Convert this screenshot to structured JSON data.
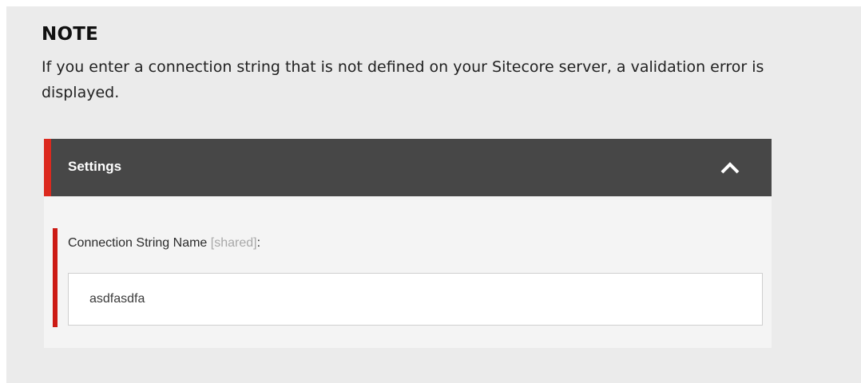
{
  "note": {
    "title": "NOTE",
    "text": "If you enter a connection string that is not defined on your Sitecore server, a validation error is displayed."
  },
  "panel": {
    "title": "Settings",
    "collapse_icon": "chevron-up-icon",
    "field": {
      "label": "Connection String Name",
      "shared_tag": "[shared]",
      "colon": ":",
      "value": "asdfasdfa"
    }
  },
  "colors": {
    "accent_red": "#dc291e",
    "header_bg": "#474747",
    "note_bg": "#ebebeb",
    "panel_body_bg": "#f4f4f4"
  }
}
